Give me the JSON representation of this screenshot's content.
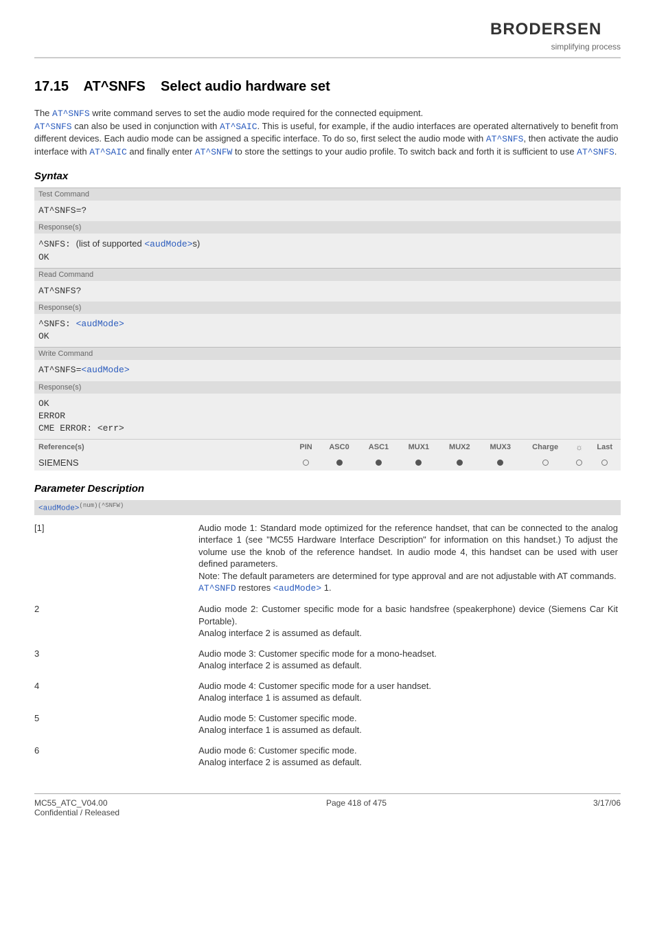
{
  "brand": {
    "name": "BRODERSEN",
    "tagline": "simplifying process"
  },
  "title": {
    "num": "17.15",
    "cmd": "AT^SNFS",
    "rest": "Select audio hardware set"
  },
  "intro": {
    "l1a": "The ",
    "l1cmd": "AT^SNFS",
    "l1b": " write command serves to set the audio mode required for the connected equipment.",
    "l2cmd1": "AT^SNFS",
    "l2a": " can also be used in conjunction with ",
    "l2cmd2": "AT^SAIC",
    "l2b": ". This is useful, for example, if the audio interfaces are operated alternatively to benefit from different devices. Each audio mode can be assigned a specific interface. To do so, first select the audio mode with ",
    "l2cmd3": "AT^SNFS",
    "l2c": ", then activate the audio interface with ",
    "l2cmd4": "AT^SAIC",
    "l2d": " and finally enter ",
    "l2cmd5": "AT^SNFW",
    "l2e": " to store the settings to your audio profile. To switch back and forth it is sufficient to use ",
    "l2cmd6": "AT^SNFS",
    "l2f": "."
  },
  "subheads": {
    "syntax": "Syntax",
    "params": "Parameter Description"
  },
  "syntax": {
    "test": {
      "hdr": "Test Command",
      "cmd": "AT^SNFS=?",
      "resp_hdr": "Response(s)",
      "r1a": "^SNFS: ",
      "r1b": "(list of supported ",
      "r1c": "<audMode>",
      "r1d": "s)",
      "r2": "OK"
    },
    "read": {
      "hdr": "Read Command",
      "cmd": "AT^SNFS?",
      "resp_hdr": "Response(s)",
      "r1a": "^SNFS: ",
      "r1b": "<audMode>",
      "r2": "OK"
    },
    "write": {
      "hdr": "Write Command",
      "cmda": "AT^SNFS=",
      "cmdb": "<audMode>",
      "resp_hdr": "Response(s)",
      "r1": "OK",
      "r2": "ERROR",
      "r3": "CME ERROR: <err>"
    },
    "ref": {
      "hdr": "Reference(s)",
      "cols": [
        "PIN",
        "ASC0",
        "ASC1",
        "MUX1",
        "MUX2",
        "MUX3",
        "Charge",
        "",
        "Last"
      ],
      "vendor": "SIEMENS",
      "vals": [
        "open",
        "filled",
        "filled",
        "filled",
        "filled",
        "filled",
        "open",
        "open",
        "open"
      ]
    }
  },
  "paramhdr": {
    "tag": "<audMode>",
    "sup": "(num)(^SNFW)"
  },
  "params": [
    {
      "key": "[1]",
      "desc_pre": "Audio mode 1: Standard mode optimized for the reference handset, that can be connected to the analog interface 1 (see \"MC55 Hardware Interface Description\" for information on this handset.) To adjust the volume use the knob of the reference handset. In audio mode 4, this handset can be used with user defined parameters.\nNote: The default parameters are determined for type approval and are not adjustable with AT commands.",
      "cmd1": "AT^SNFD",
      "mid": " restores ",
      "cmd2": "<audMode>",
      "tail": " 1."
    },
    {
      "key": "2",
      "desc": "Audio mode 2: Customer specific mode for a basic handsfree (speakerphone) device (Siemens Car Kit Portable).\nAnalog interface 2 is assumed as default."
    },
    {
      "key": "3",
      "desc": "Audio mode 3: Customer specific mode for a mono-headset.\nAnalog interface 2 is assumed as default."
    },
    {
      "key": "4",
      "desc": "Audio mode 4: Customer specific mode for a user handset.\nAnalog interface 1 is assumed as default."
    },
    {
      "key": "5",
      "desc": "Audio mode 5: Customer specific mode.\nAnalog interface 1 is assumed as default."
    },
    {
      "key": "6",
      "desc": "Audio mode 6: Customer specific mode.\nAnalog interface 2 is assumed as default."
    }
  ],
  "footer": {
    "left1": "MC55_ATC_V04.00",
    "left2": "Confidential / Released",
    "center": "Page 418 of 475",
    "right": "3/17/06"
  }
}
